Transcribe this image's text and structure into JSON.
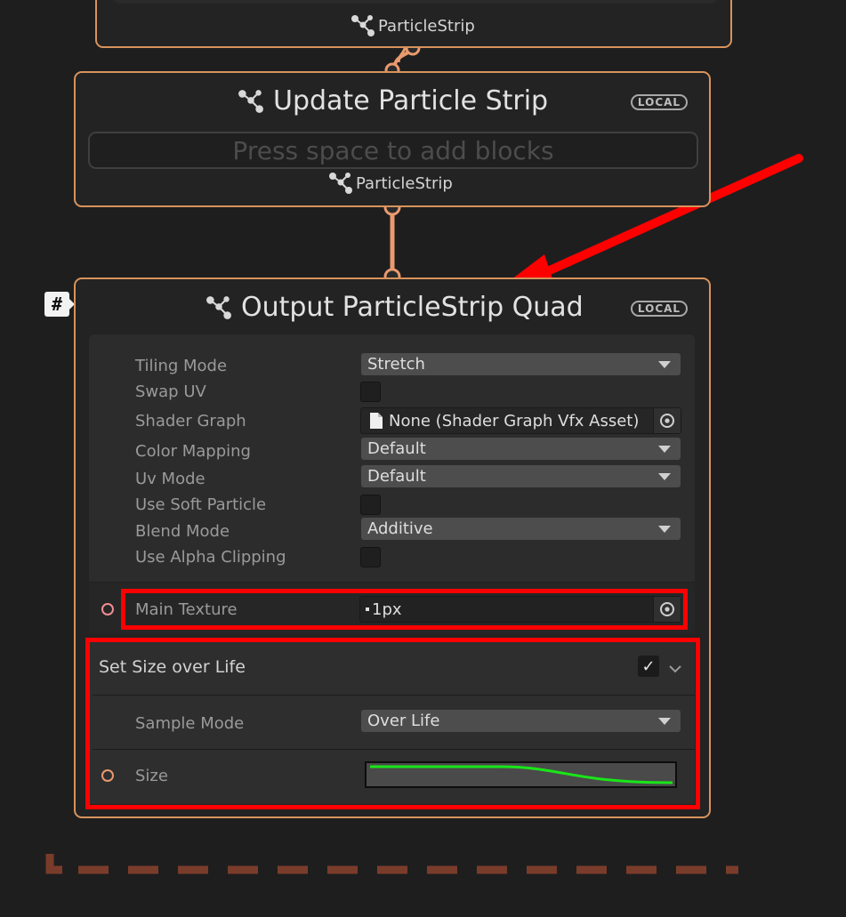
{
  "top_node": {
    "particle_type": "ParticleStrip"
  },
  "update_node": {
    "title": "Update Particle Strip",
    "badge": "LOCAL",
    "placeholder": "Press space to add blocks",
    "particle_type": "ParticleStrip"
  },
  "output_node": {
    "title": "Output ParticleStrip Quad",
    "badge": "LOCAL",
    "sticky_badge": "#",
    "settings": {
      "tiling_mode": {
        "label": "Tiling Mode",
        "value": "Stretch"
      },
      "swap_uv": {
        "label": "Swap UV",
        "checked": false
      },
      "shader_graph": {
        "label": "Shader Graph",
        "value": "None (Shader Graph Vfx Asset)"
      },
      "color_mapping": {
        "label": "Color Mapping",
        "value": "Default"
      },
      "uv_mode": {
        "label": "Uv Mode",
        "value": "Default"
      },
      "use_soft_particle": {
        "label": "Use Soft Particle",
        "checked": false
      },
      "blend_mode": {
        "label": "Blend Mode",
        "value": "Additive"
      },
      "use_alpha_clipping": {
        "label": "Use Alpha Clipping",
        "checked": false
      }
    },
    "main_texture": {
      "label": "Main Texture",
      "value": "1px"
    },
    "block": {
      "title": "Set Size over Life",
      "enabled": true,
      "sample_mode": {
        "label": "Sample Mode",
        "value": "Over Life"
      },
      "size": {
        "label": "Size"
      }
    }
  },
  "colors": {
    "node_border": "#d7935c",
    "annotation_red": "#ff0000",
    "curve_green": "#19e619"
  },
  "icons": {
    "particle_system": "particle-system-icon",
    "object_picker": "object-picker-icon",
    "file": "file-icon",
    "checkmark": "checkmark-icon",
    "chevron": "chevron-down-icon"
  }
}
